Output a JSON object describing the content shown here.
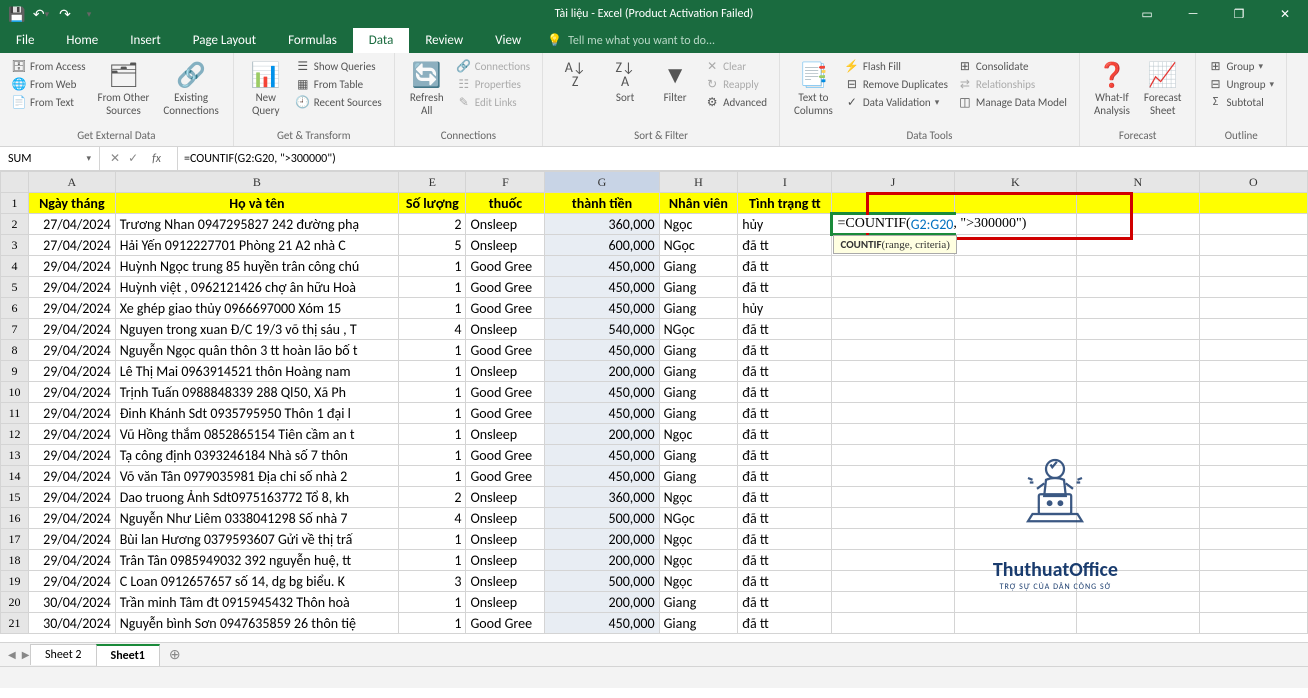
{
  "titlebar": {
    "title": "Tài liệu - Excel (Product Activation Failed)"
  },
  "tabs": {
    "file": "File",
    "home": "Home",
    "insert": "Insert",
    "page_layout": "Page Layout",
    "formulas": "Formulas",
    "data": "Data",
    "review": "Review",
    "view": "View",
    "tell_me": "Tell me what you want to do..."
  },
  "ribbon": {
    "get_external": {
      "from_access": "From Access",
      "from_web": "From Web",
      "from_text": "From Text",
      "from_other": "From Other\nSources",
      "existing": "Existing\nConnections",
      "label": "Get External Data"
    },
    "get_transform": {
      "new_query": "New\nQuery",
      "show_queries": "Show Queries",
      "from_table": "From Table",
      "recent": "Recent Sources",
      "label": "Get & Transform"
    },
    "connections": {
      "refresh": "Refresh\nAll",
      "connections": "Connections",
      "properties": "Properties",
      "edit_links": "Edit Links",
      "label": "Connections"
    },
    "sort_filter": {
      "sort": "Sort",
      "filter": "Filter",
      "clear": "Clear",
      "reapply": "Reapply",
      "advanced": "Advanced",
      "label": "Sort & Filter"
    },
    "data_tools": {
      "text_to_columns": "Text to\nColumns",
      "flash_fill": "Flash Fill",
      "remove_dup": "Remove Duplicates",
      "data_validation": "Data Validation",
      "consolidate": "Consolidate",
      "relationships": "Relationships",
      "manage_model": "Manage Data Model",
      "label": "Data Tools"
    },
    "forecast": {
      "whatif": "What-If\nAnalysis",
      "forecast_sheet": "Forecast\nSheet",
      "label": "Forecast"
    },
    "outline": {
      "group": "Group",
      "ungroup": "Ungroup",
      "subtotal": "Subtotal",
      "label": "Outline"
    }
  },
  "formula_bar": {
    "name_box": "SUM",
    "formula": "=COUNTIF(G2:G20, \">300000\")"
  },
  "columns": [
    "A",
    "B",
    "E",
    "F",
    "G",
    "H",
    "I",
    "J",
    "K",
    "N",
    "O"
  ],
  "headers": {
    "A": "Ngày tháng",
    "B": "Họ và tên",
    "E": "Số lượng",
    "F": "thuốc",
    "G": "thành tiền",
    "H": "Nhân viên",
    "I": "Tình trạng tt"
  },
  "rows": [
    {
      "n": 2,
      "A": "27/04/2024",
      "B": "Trương Nhan 0947295827 242 đường phạ",
      "E": "2",
      "F": "Onsleep",
      "G": "360,000",
      "H": "Ngọc",
      "I": "hủy"
    },
    {
      "n": 3,
      "A": "27/04/2024",
      "B": "Hải Yến 0912227701 Phòng 21 A2 nhà C",
      "E": "5",
      "F": "Onsleep",
      "G": "600,000",
      "H": "NGọc",
      "I": "đã tt"
    },
    {
      "n": 4,
      "A": "29/04/2024",
      "B": "Huỳnh Ngọc trung 85 huyền trân công chú",
      "E": "1",
      "F": "Good Gree",
      "G": "450,000",
      "H": "Giang",
      "I": "đã tt"
    },
    {
      "n": 5,
      "A": "29/04/2024",
      "B": "Huỳnh việt , 0962121426 chợ ân hữu Hoà",
      "E": "1",
      "F": "Good Gree",
      "G": "450,000",
      "H": "Giang",
      "I": "đã tt"
    },
    {
      "n": 6,
      "A": "29/04/2024",
      "B": "Xe ghép giao thủy 0966697000 Xóm 15",
      "E": "1",
      "F": "Good Gree",
      "G": "450,000",
      "H": "Giang",
      "I": "hủy"
    },
    {
      "n": 7,
      "A": "29/04/2024",
      "B": "Nguyen trong xuan Đ/C 19/3 võ thị sáu , T",
      "E": "4",
      "F": "Onsleep",
      "G": "540,000",
      "H": "NGọc",
      "I": "đã tt"
    },
    {
      "n": 8,
      "A": "29/04/2024",
      "B": "Nguyễn Ngọc quân thôn 3 tt hoàn lão bố t",
      "E": "1",
      "F": "Good Gree",
      "G": "450,000",
      "H": "Giang",
      "I": "đã tt"
    },
    {
      "n": 9,
      "A": "29/04/2024",
      "B": "Lê Thị Mai 0963914521 thôn Hoàng nam",
      "E": "1",
      "F": "Onsleep",
      "G": "200,000",
      "H": "Giang",
      "I": "đã tt"
    },
    {
      "n": 10,
      "A": "29/04/2024",
      "B": "Trịnh Tuấn 0988848339 288 Ql50, Xã Ph",
      "E": "1",
      "F": "Good Gree",
      "G": "450,000",
      "H": "Giang",
      "I": "đã tt"
    },
    {
      "n": 11,
      "A": "29/04/2024",
      "B": "Đinh Khánh Sdt 0935795950 Thôn 1 đại l",
      "E": "1",
      "F": "Good Gree",
      "G": "450,000",
      "H": "Giang",
      "I": "đã tt"
    },
    {
      "n": 12,
      "A": "29/04/2024",
      "B": "Vũ Hồng thắm 0852865154 Tiên cầm an t",
      "E": "1",
      "F": "Onsleep",
      "G": "200,000",
      "H": "Ngọc",
      "I": "đã tt"
    },
    {
      "n": 13,
      "A": "29/04/2024",
      "B": "Tạ công định 0393246184 Nhà số 7 thôn",
      "E": "1",
      "F": "Good Gree",
      "G": "450,000",
      "H": "Giang",
      "I": "đã tt"
    },
    {
      "n": 14,
      "A": "29/04/2024",
      "B": " Võ văn Tân 0979035981 Địa chỉ số nhà 2",
      "E": "1",
      "F": "Good Gree",
      "G": "450,000",
      "H": "Giang",
      "I": "đã tt"
    },
    {
      "n": 15,
      "A": "29/04/2024",
      "B": "Dao truong Ảnh  Sdt0975163772 Tổ 8, kh",
      "E": "2",
      "F": "Onsleep",
      "G": "360,000",
      "H": "Ngọc",
      "I": "đã tt"
    },
    {
      "n": 16,
      "A": "29/04/2024",
      "B": "Nguyễn Như Liêm 0338041298 Số nhà 7",
      "E": "4",
      "F": "Onsleep",
      "G": "500,000",
      "H": "NGọc",
      "I": "đã tt"
    },
    {
      "n": 17,
      "A": "29/04/2024",
      "B": "Bùi lan Hương 0379593607 Gửi về thị trấ",
      "E": "1",
      "F": "Onsleep",
      "G": "200,000",
      "H": "Ngọc",
      "I": "đã tt"
    },
    {
      "n": 18,
      "A": "29/04/2024",
      "B": "Trân Tân 0985949032 392  nguyễn huệ, tt",
      "E": "1",
      "F": "Onsleep",
      "G": "200,000",
      "H": "Ngọc",
      "I": "đã tt"
    },
    {
      "n": 19,
      "A": "29/04/2024",
      "B": "C Loan 0912657657 số 14, dg bg biểu. K",
      "E": "3",
      "F": "Onsleep",
      "G": "500,000",
      "H": "Ngọc",
      "I": "đã tt"
    },
    {
      "n": 20,
      "A": "30/04/2024",
      "B": " Trần minh Tâm đt 0915945432 Thôn hoà",
      "E": "1",
      "F": "Onsleep",
      "G": "200,000",
      "H": "Giang",
      "I": "đã tt"
    },
    {
      "n": 21,
      "A": "30/04/2024",
      "B": "Nguyễn bình Sơn 0947635859 26 thôn tiệ",
      "E": "1",
      "F": "Good Gree",
      "G": "450,000",
      "H": "Giang",
      "I": "đã tt"
    }
  ],
  "formula_cell": {
    "prefix": "=COUNTIF(",
    "range": "G2:G20",
    "suffix": ", \">300000\")",
    "tooltip_bold": "COUNTIF",
    "tooltip_rest": "(range, criteria)"
  },
  "sheet_tabs": {
    "sheet2": "Sheet 2",
    "sheet1": "Sheet1"
  },
  "watermark": {
    "brand": "ThuthuatOffice",
    "tag": "TRỢ SỰ CỦA DÂN CÔNG SỞ"
  }
}
